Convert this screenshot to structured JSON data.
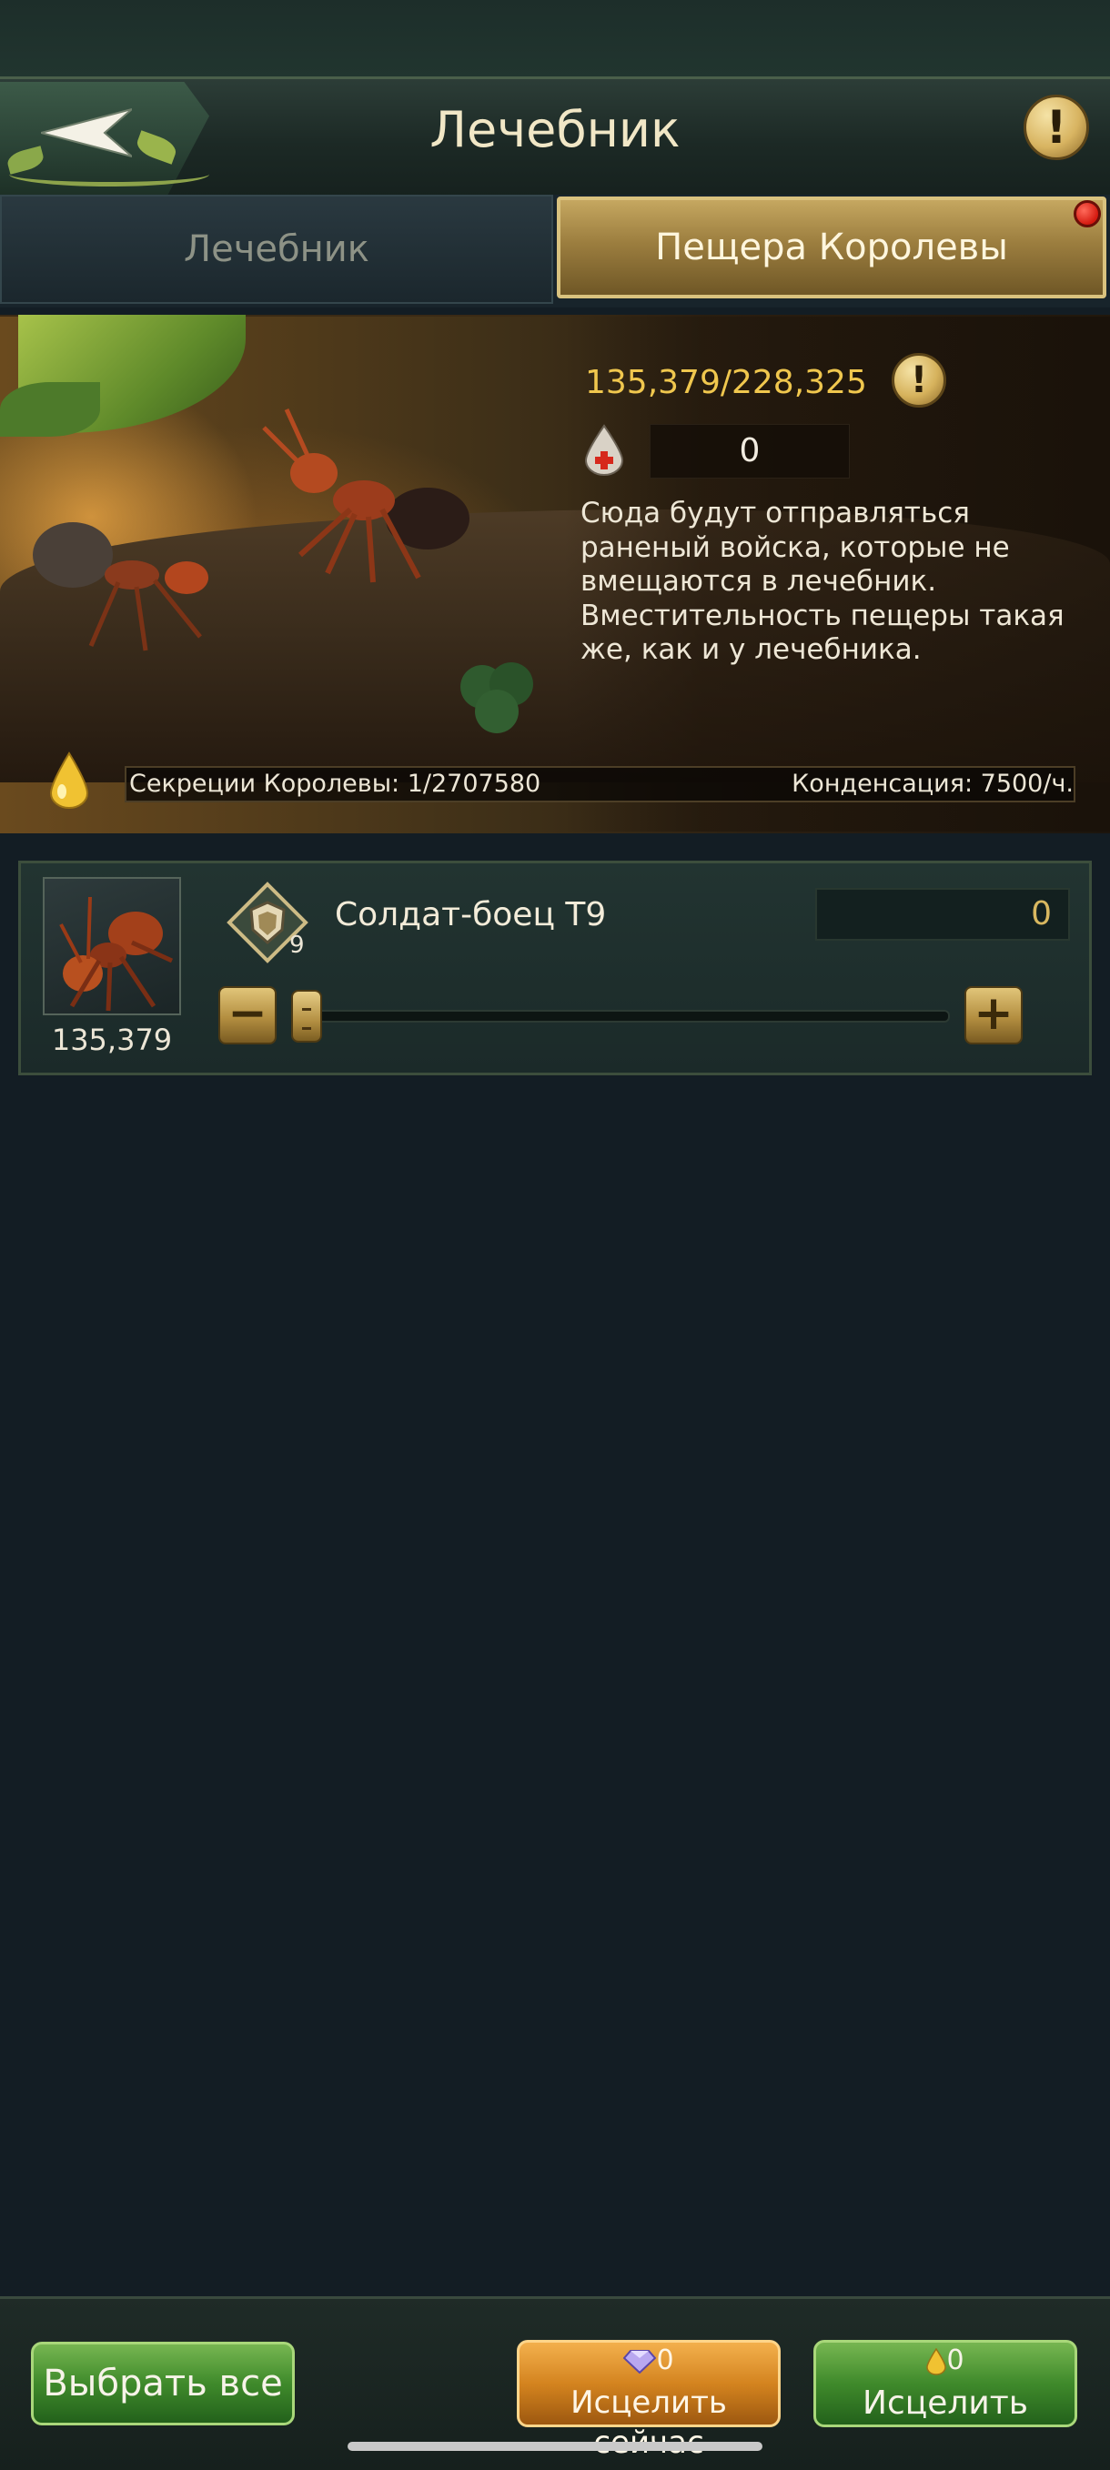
{
  "header": {
    "title": "Лечебник",
    "info_icon": "!"
  },
  "tabs": [
    {
      "label": "Лечебник",
      "active": false
    },
    {
      "label": "Пещера Королевы",
      "active": true
    }
  ],
  "banner": {
    "capacity": "135,379/228,325",
    "heal_count": "0",
    "description": "Сюда будут отправляться раненый войска, которые не вмещаются в лечебник. Вместительность пещеры такая же, как и у лечебника.",
    "secretion_label": "Секреции Королевы: 1/2707580",
    "condensation_label": "Конденсация: 7500/ч."
  },
  "troop": {
    "count": "135,379",
    "tier": "9",
    "name": "Солдат-боец T9",
    "quantity": "0",
    "minus": "−",
    "plus": "+",
    "slider_fraction": 0
  },
  "bottom": {
    "select_all": "Выбрать все",
    "heal_now_cost": "0",
    "heal_now_label": "Исцелить сейчас",
    "heal_cost": "0",
    "heal_label": "Исцелить"
  },
  "colors": {
    "accent_gold": "#f0c74e",
    "button_green": "#3f8a2b",
    "button_orange": "#d4841f",
    "background": "#131d24"
  }
}
